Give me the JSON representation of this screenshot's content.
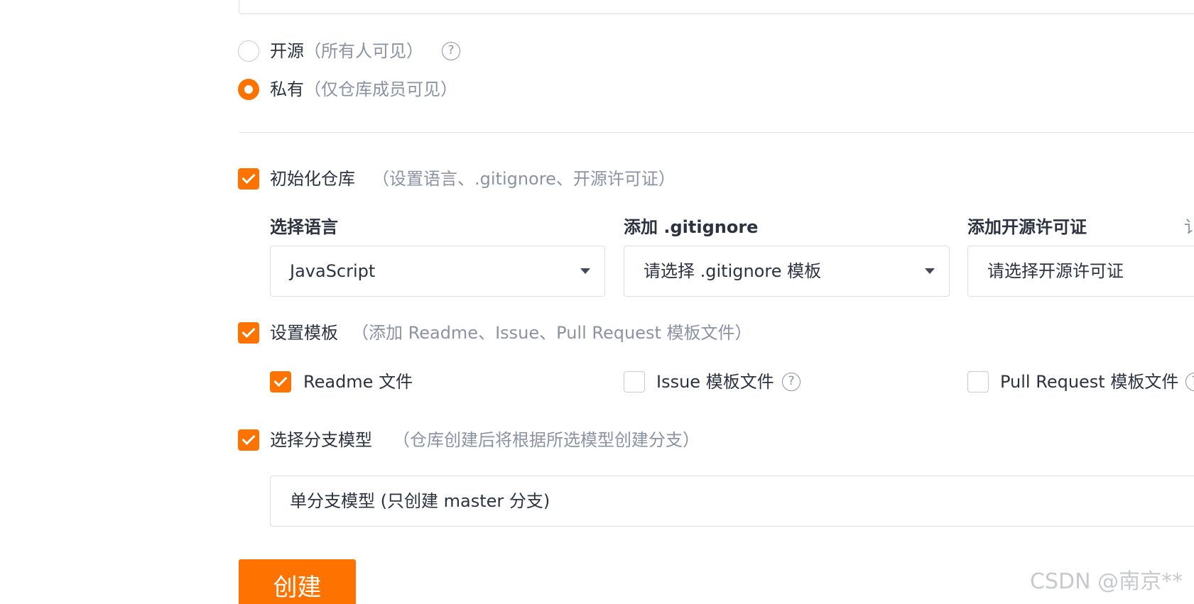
{
  "visibility": {
    "public": {
      "label": "开源",
      "hint": "（所有人可见）",
      "selected": false
    },
    "private": {
      "label": "私有",
      "hint": "（仅仓库成员可见）",
      "selected": true
    }
  },
  "init_repo": {
    "checked": true,
    "label": "初始化仓库",
    "hint": "（设置语言、.gitignore、开源许可证）",
    "language": {
      "title": "选择语言",
      "value": "JavaScript"
    },
    "gitignore": {
      "title": "添加 .gitignore",
      "value": "请选择 .gitignore 模板"
    },
    "license": {
      "title": "添加开源许可证",
      "value": "请选择开源许可证",
      "extra": "讠"
    }
  },
  "templates": {
    "checked": true,
    "label": "设置模板",
    "hint": "（添加 Readme、Issue、Pull Request 模板文件）",
    "items": [
      {
        "label": "Readme 文件",
        "checked": true
      },
      {
        "label": "Issue 模板文件",
        "checked": false
      },
      {
        "label": "Pull Request 模板文件",
        "checked": false
      }
    ]
  },
  "branch_model": {
    "checked": true,
    "label": "选择分支模型",
    "hint": "（仓库创建后将根据所选模型创建分支）",
    "value": "单分支模型 (只创建 master 分支)"
  },
  "create_button": {
    "label": "创建"
  },
  "watermark": "CSDN @南京**",
  "colors": {
    "accent": "#fe7300",
    "hint": "#8c92a4",
    "border": "#dcdfe6"
  }
}
